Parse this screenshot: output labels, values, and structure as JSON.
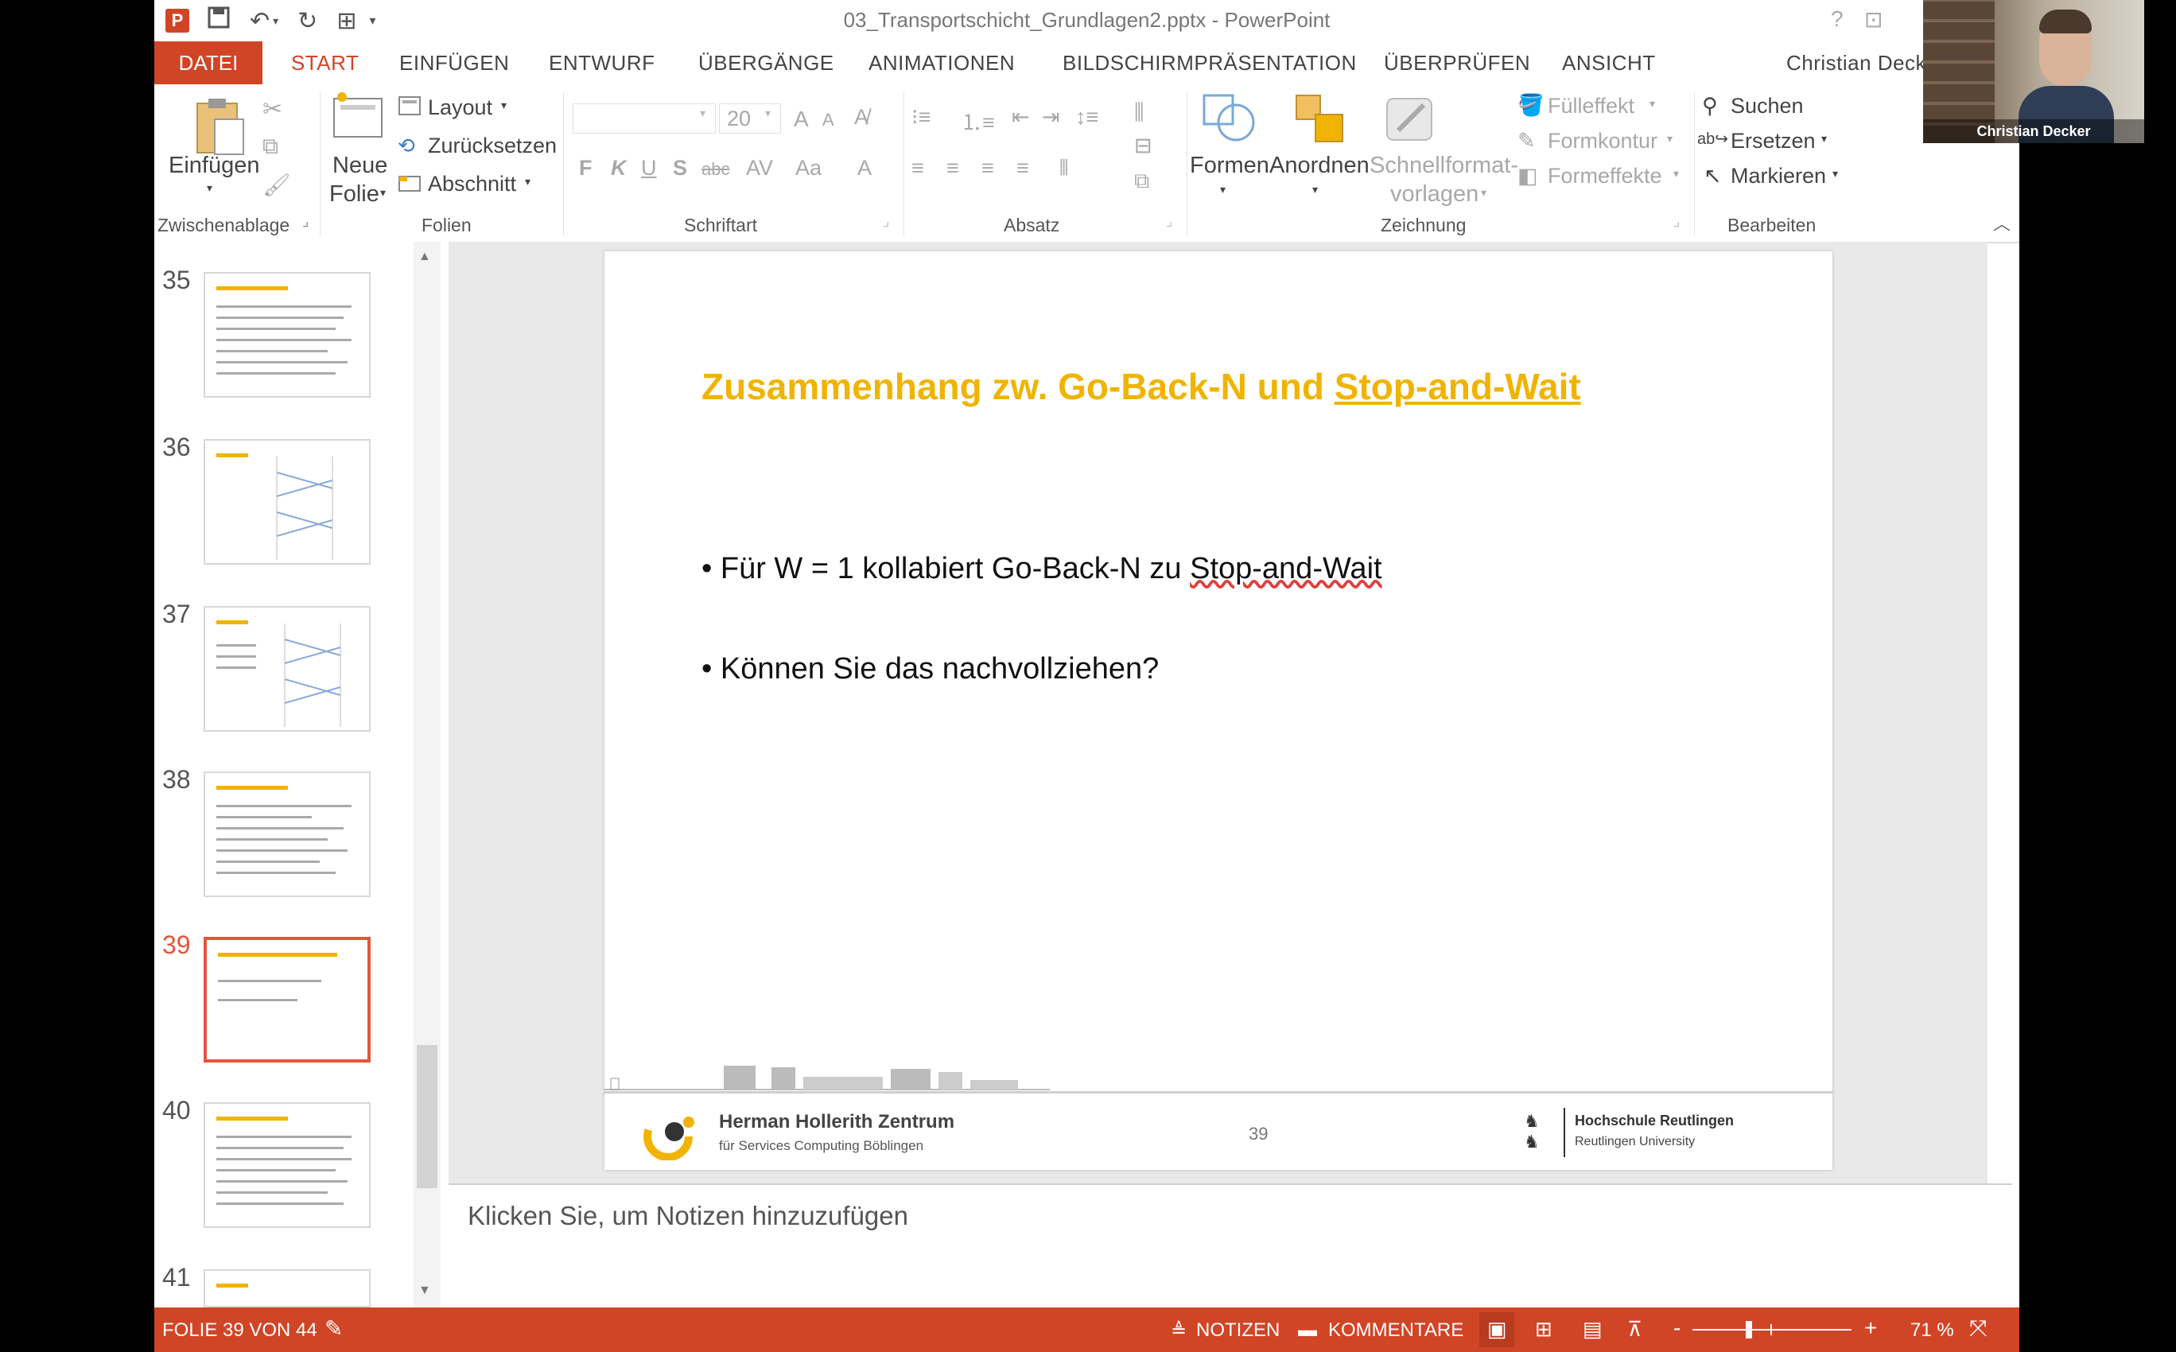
{
  "window": {
    "title": "03_Transportschicht_Grundlagen2.pptx - PowerPoint",
    "help": "?",
    "restore": "⊡"
  },
  "tabs": {
    "datei": "DATEI",
    "start": "START",
    "einfuegen": "EINFÜGEN",
    "entwurf": "ENTWURF",
    "uebergaenge": "ÜBERGÄNGE",
    "animationen": "ANIMATIONEN",
    "praesentation": "BILDSCHIRMPRÄSENTATION",
    "ueberpruefen": "ÜBERPRÜFEN",
    "ansicht": "ANSICHT",
    "user": "Christian Deck"
  },
  "ribbon": {
    "clipboard": {
      "paste": "Einfügen",
      "label": "Zwischenablage"
    },
    "slides": {
      "new_slide_1": "Neue",
      "new_slide_2": "Folie",
      "layout": "Layout",
      "reset": "Zurücksetzen",
      "section": "Abschnitt",
      "label": "Folien"
    },
    "font": {
      "size": "20",
      "bold": "F",
      "italic": "K",
      "underline": "U",
      "shadow": "S",
      "strike": "abc",
      "spacing": "AV",
      "case": "Aa",
      "color": "A",
      "grow": "A",
      "shrink": "A",
      "label": "Schriftart"
    },
    "paragraph": {
      "label": "Absatz"
    },
    "drawing": {
      "shapes": "Formen",
      "arrange": "Anordnen",
      "quickstyles_1": "Schnellformat-",
      "quickstyles_2": "vorlagen",
      "fill": "Fülleffekt",
      "outline": "Formkontur",
      "effects": "Formeffekte",
      "label": "Zeichnung"
    },
    "editing": {
      "find": "Suchen",
      "replace": "Ersetzen",
      "select": "Markieren",
      "label": "Bearbeiten"
    }
  },
  "thumbnails": [
    {
      "number": "35"
    },
    {
      "number": "36"
    },
    {
      "number": "37"
    },
    {
      "number": "38"
    },
    {
      "number": "39"
    },
    {
      "number": "40"
    },
    {
      "number": "41"
    }
  ],
  "slide": {
    "title_part1": "Zusammenhang zw. Go-Back-N und ",
    "title_part2": "Stop-and-Wait",
    "bullet1_part1": "• Für W = 1 kollabiert Go-Back-N zu ",
    "bullet1_part2": "Stop-and-Wait",
    "bullet2": "• Können Sie das nachvollziehen?",
    "footer_logo_1": "Herman Hollerith Zentrum",
    "footer_logo_2": "für Services Computing Böblingen",
    "page_number": "39",
    "university_1": "Hochschule Reutlingen",
    "university_2": "Reutlingen University"
  },
  "notes": {
    "placeholder": "Klicken Sie, um Notizen hinzuzufügen"
  },
  "statusbar": {
    "slide_info": "FOLIE 39 VON 44",
    "notes": "NOTIZEN",
    "comments": "KOMMENTARE",
    "zoom_minus": "-",
    "zoom_plus": "+",
    "zoom": "71 %",
    "zoom_fraction": 0.71
  },
  "webcam": {
    "name": "Christian Decker"
  },
  "colors": {
    "accent": "#d04526",
    "slide_title": "#f0b400"
  }
}
